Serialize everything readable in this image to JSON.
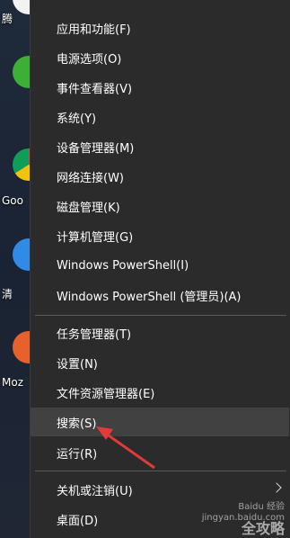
{
  "desktop": {
    "labels": [
      "腾",
      "Goo",
      "清",
      "Moz"
    ]
  },
  "menu": {
    "group1": [
      "应用和功能(F)",
      "电源选项(O)",
      "事件查看器(V)",
      "系统(Y)",
      "设备管理器(M)",
      "网络连接(W)",
      "磁盘管理(K)",
      "计算机管理(G)",
      "Windows PowerShell(I)",
      "Windows PowerShell (管理员)(A)"
    ],
    "group2": [
      "任务管理器(T)",
      "设置(N)",
      "文件资源管理器(E)",
      "搜索(S)",
      "运行(R)"
    ],
    "group3": [
      "关机或注销(U)",
      "桌面(D)"
    ],
    "highlighted": "搜索(S)"
  },
  "watermark": {
    "line1": "Baidu 经验",
    "line2": "jingyan.baidu.com",
    "line3": "全攻略"
  },
  "colors": {
    "menu_bg": "#2b2b2b",
    "highlight_bg": "#414141",
    "arrow": "#e03a3a"
  }
}
